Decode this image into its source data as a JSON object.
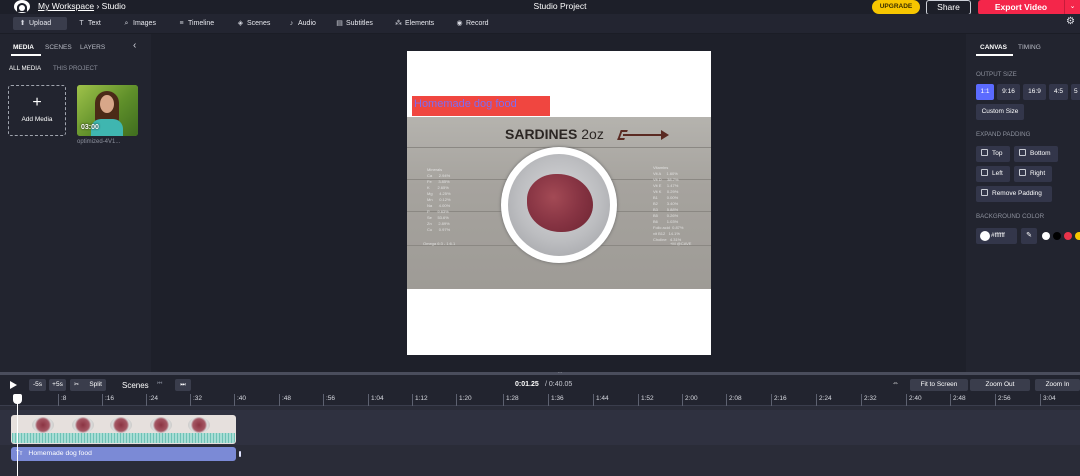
{
  "header": {
    "workspace_link": "My Workspace",
    "separator": "›",
    "section": "Studio",
    "project_title": "Studio Project",
    "upgrade_label": "UPGRADE",
    "share_label": "Share",
    "export_label": "Export Video",
    "export_caret": "⌄"
  },
  "toolbar": {
    "items": [
      {
        "label": "Upload",
        "icon": "upload-icon",
        "glyph": "⬆"
      },
      {
        "label": "Text",
        "icon": "text-icon",
        "glyph": "T"
      },
      {
        "label": "Images",
        "icon": "search-icon",
        "glyph": "⌕"
      },
      {
        "label": "Timeline",
        "icon": "timeline-icon",
        "glyph": "≡"
      },
      {
        "label": "Scenes",
        "icon": "scenes-icon",
        "glyph": "◈"
      },
      {
        "label": "Audio",
        "icon": "music-note-icon",
        "glyph": "♪"
      },
      {
        "label": "Subtitles",
        "icon": "subtitles-icon",
        "glyph": "▤"
      },
      {
        "label": "Elements",
        "icon": "elements-icon",
        "glyph": "⁂"
      },
      {
        "label": "Record",
        "icon": "record-icon",
        "glyph": "◉"
      }
    ],
    "settings_glyph": "⚙"
  },
  "left_panel": {
    "tabs": [
      "MEDIA",
      "SCENES",
      "LAYERS"
    ],
    "collapse_glyph": "‹",
    "subtabs": [
      "ALL MEDIA",
      "THIS PROJECT"
    ],
    "add_media_plus": "+",
    "add_media_label": "Add Media",
    "thumb_duration": "03:00",
    "thumb_filename": "optimized-4V1..."
  },
  "canvas": {
    "caption_text": "Homemade dog food",
    "image_title": "SARDINES",
    "image_title_suffix": " 2oz",
    "nutrient_col_left": "Minerals\nCa      2.94%\nFe      3.85%\nK       2.65%\nMg      4.25%\nMn      0.12%\nNa      4.00%\nP       9.63%\nSe     53.6%\nZn      2.89%\nCu      0.97%",
    "nutrient_col_right": "Vitamins\nVit A     1.60%\nVit D     38.7%\nVit E     1.47%\nVit K     0.29%\nB1        0.00%\nB2        3.40%\nB3        5.88%\nB5        0.26%\nB6        1.03%\nFolic acid  0.87%\nvit B12   14.1%\nCholine   4.31%",
    "footer_left": "Omega 6:3 - 1:6.1",
    "footer_right": "+M  @CAVE"
  },
  "right_panel": {
    "tabs": [
      "CANVAS",
      "TIMING"
    ],
    "output_size_label": "OUTPUT SIZE",
    "sizes": [
      "1:1",
      "9:16",
      "16:9",
      "4:5",
      "5"
    ],
    "active_size": "1:1",
    "custom_size_label": "Custom Size",
    "expand_padding_label": "EXPAND PADDING",
    "padding": [
      "Top",
      "Bottom",
      "Left",
      "Right"
    ],
    "remove_padding_label": "Remove Padding",
    "background_color_label": "BACKGROUND COLOR",
    "background_color_value": "#ffffff",
    "eyedropper_glyph": "✎",
    "presets": [
      "#ffffff",
      "#000000",
      "#e8334a",
      "#f7c600"
    ]
  },
  "timeline": {
    "minus_label": "-5s",
    "plus_label": "+5s",
    "split_label": "Split",
    "scenes_label": "Scenes",
    "scene_prev_glyph": "⏮",
    "scene_next_glyph": "⏭",
    "current_time": "0:01.25",
    "total_time": "/ 0:40.05",
    "fit_label": "Fit to Screen",
    "zoom_out_label": "Zoom Out",
    "zoom_in_label": "Zoom In",
    "ruler_labels": [
      ":8",
      ":16",
      ":24",
      ":32",
      ":40",
      ":48",
      ":56",
      "1:04",
      "1:12",
      "1:20",
      "1:28",
      "1:36",
      "1:44",
      "1:52",
      "2:00",
      "2:08",
      "2:16",
      "2:24",
      "2:32",
      "2:40",
      "2:48",
      "2:56",
      "3:04"
    ],
    "text_clip_icon": "Tт",
    "text_clip_label": "Homemade dog food"
  }
}
